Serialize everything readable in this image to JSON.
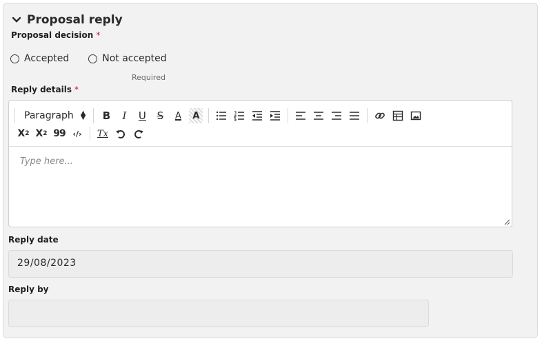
{
  "section": {
    "title": "Proposal reply"
  },
  "decision": {
    "label": "Proposal decision",
    "required_mark": "*",
    "options": [
      "Accepted",
      "Not accepted"
    ],
    "hint": "Required"
  },
  "reply_details": {
    "label": "Reply details",
    "required_mark": "*",
    "toolbar": {
      "paragraph": "Paragraph",
      "bold": "B",
      "italic": "I",
      "underline": "U",
      "strike": "S",
      "font_color": "A",
      "highlight": "A",
      "subscript_base": "X",
      "subscript_mark": "2",
      "superscript_base": "X",
      "superscript_mark": "2",
      "quote": "99",
      "code": "‹/›",
      "clear_format": "Tx"
    },
    "placeholder": "Type here..."
  },
  "reply_date": {
    "label": "Reply date",
    "value": "29/08/2023"
  },
  "reply_by": {
    "label": "Reply by",
    "value": ""
  },
  "colors": {
    "required": "#c8102e",
    "panel": "#f2f2f2",
    "field": "#ededed"
  }
}
